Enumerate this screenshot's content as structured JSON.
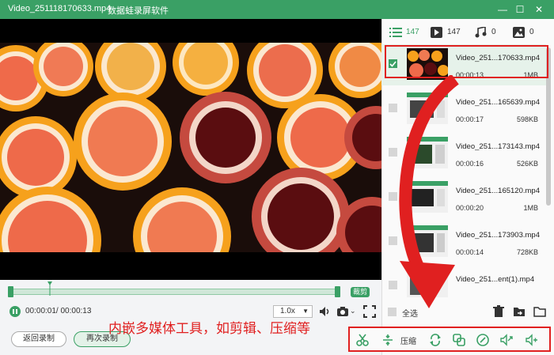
{
  "window": {
    "title": "Video_251118170633.mp4",
    "app_name": "数据蛙录屏软件",
    "controls": [
      "minimize-icon",
      "maximize-icon",
      "close-icon"
    ]
  },
  "player": {
    "time": "00:00:01/ 00:00:13",
    "speed": "1.0x",
    "clip_button": "裁剪"
  },
  "actions": {
    "back_to_record": "返回录制",
    "record_again": "再次录制"
  },
  "tabs": [
    {
      "icon": "list-icon",
      "count": "147"
    },
    {
      "icon": "video-icon",
      "count": "147"
    },
    {
      "icon": "music-icon",
      "count": "0"
    },
    {
      "icon": "image-icon",
      "count": "0"
    }
  ],
  "files": [
    {
      "name": "Video_251...170633.mp4",
      "duration": "00:00:13",
      "size": "1MB",
      "selected": true
    },
    {
      "name": "Video_251...165639.mp4",
      "duration": "00:00:17",
      "size": "598KB",
      "selected": false
    },
    {
      "name": "Video_251...173143.mp4",
      "duration": "00:00:16",
      "size": "526KB",
      "selected": false
    },
    {
      "name": "Video_251...165120.mp4",
      "duration": "00:00:20",
      "size": "1MB",
      "selected": false
    },
    {
      "name": "Video_251...173903.mp4",
      "duration": "00:00:14",
      "size": "728KB",
      "selected": false
    },
    {
      "name": "Video_251...ent(1).mp4",
      "duration": "",
      "size": "",
      "selected": false
    }
  ],
  "select_all": "全选",
  "toolbar": {
    "compress_label": "压缩",
    "tools": [
      "scissors-icon",
      "compress-icon",
      "convert-icon",
      "merge-icon",
      "edit-icon",
      "audio-extract-icon",
      "volume-icon"
    ]
  },
  "annotation": "内嵌多媒体工具，如剪辑、压缩等",
  "colors": {
    "accent": "#3aa065",
    "highlight": "#e02020"
  }
}
